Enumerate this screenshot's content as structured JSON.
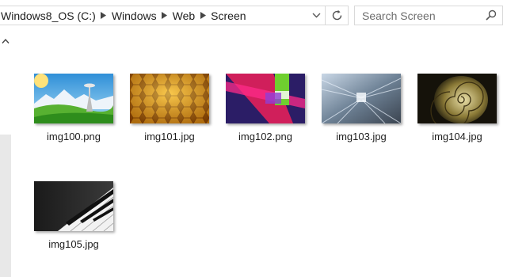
{
  "address_bar": {
    "breadcrumbs": [
      "Windows8_OS (C:)",
      "Windows",
      "Web",
      "Screen"
    ]
  },
  "search": {
    "placeholder": "Search Screen"
  },
  "icons": {
    "history": "chevron-down-icon",
    "refresh": "refresh-icon",
    "search": "search-icon",
    "breadcrumb_separator": "chevron-right-icon",
    "scroll_up": "chevron-up-icon"
  },
  "files": [
    {
      "name": "img100.png",
      "thumbnail": "Seattle Space Needle with mountains and green hills"
    },
    {
      "name": "img101.jpg",
      "thumbnail": "orange honeycomb hexagons"
    },
    {
      "name": "img102.png",
      "thumbnail": "abstract pink, green and purple shapes"
    },
    {
      "name": "img103.jpg",
      "thumbnail": "motion blurred city transit tunnel"
    },
    {
      "name": "img104.jpg",
      "thumbnail": "nautilus shell spiral"
    },
    {
      "name": "img105.jpg",
      "thumbnail": "piano keys"
    }
  ],
  "colors": {
    "border": "#d9d9d9",
    "text": "#1e1e1e",
    "placeholder": "#6d6d6d"
  }
}
